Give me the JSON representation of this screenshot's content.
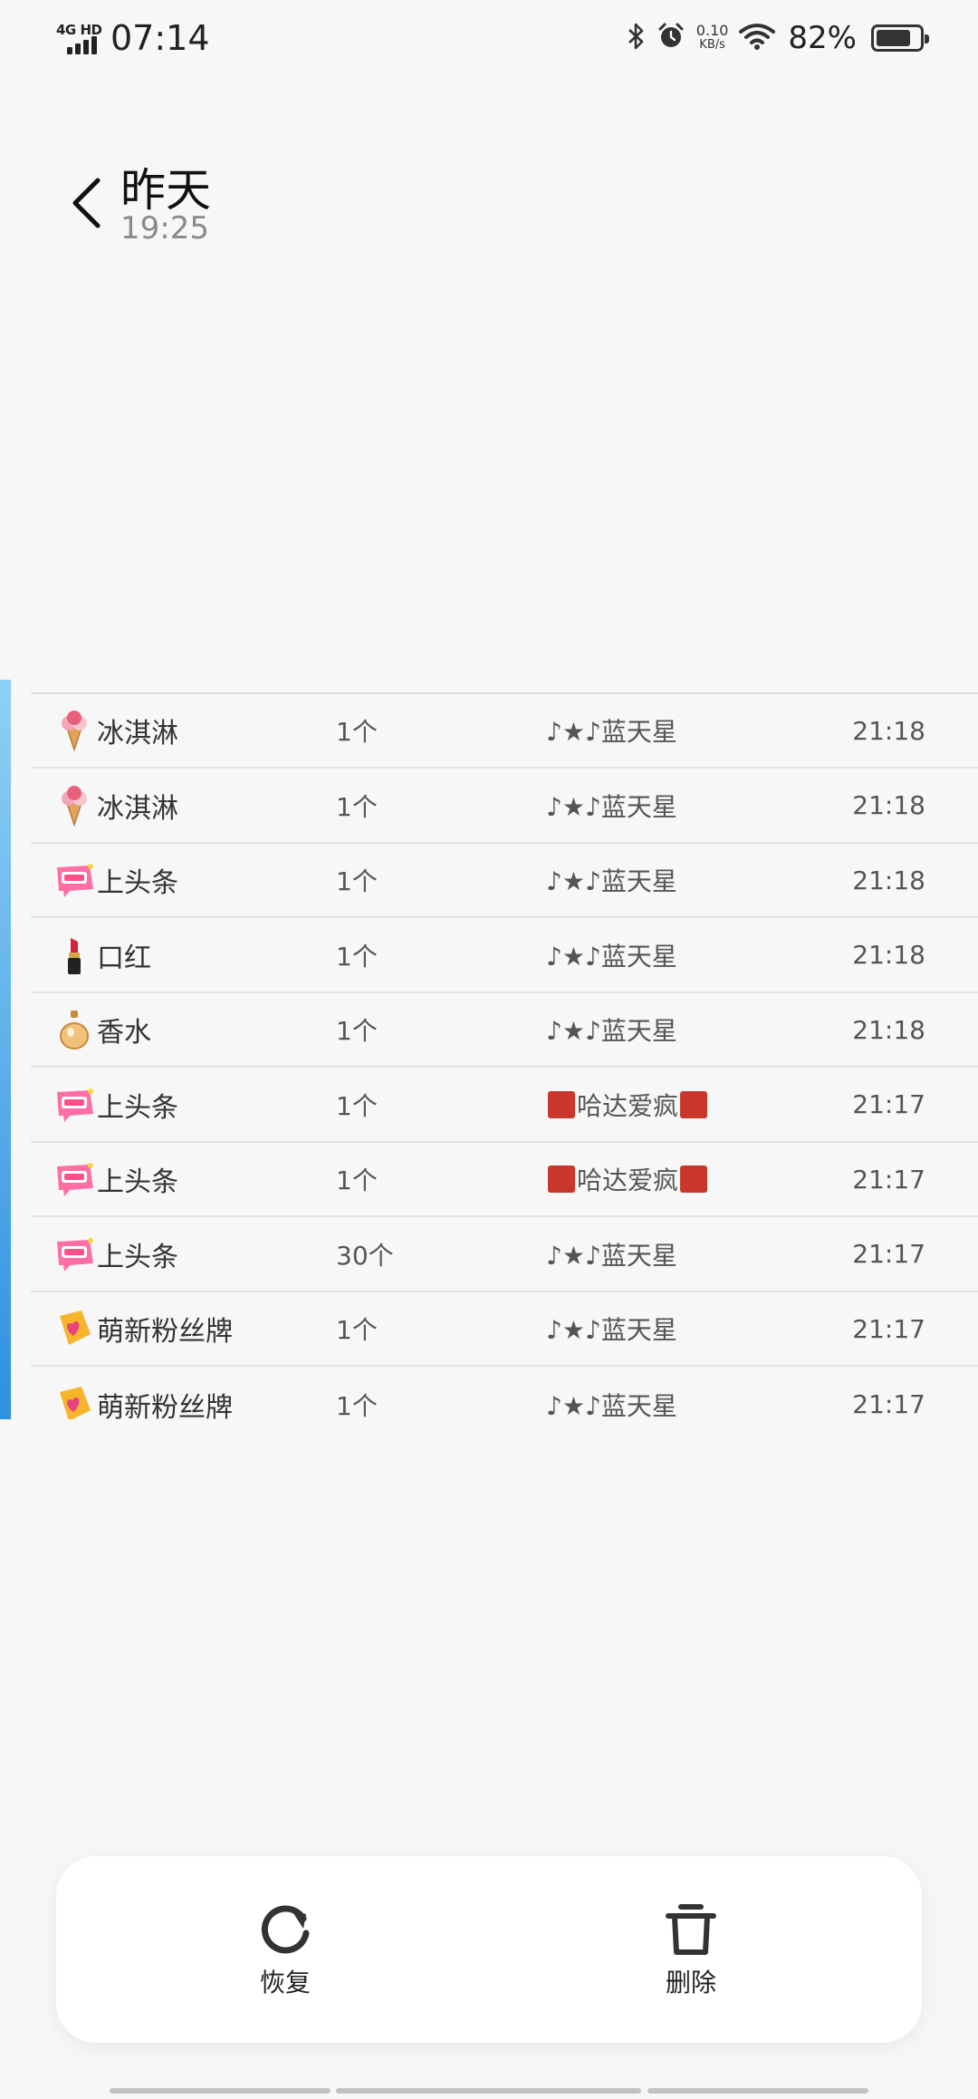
{
  "status_bar": {
    "network": "4G HD",
    "time": "07:14",
    "speed_value": "0.10",
    "speed_unit": "KB/s",
    "battery_percent": "82%",
    "battery_level": 0.82
  },
  "header": {
    "title": "昨天",
    "subtitle": "19:25"
  },
  "gift_records": [
    {
      "gift": "冰淇淋",
      "icon": "ice-cream-icon",
      "qty": "1个",
      "sender": "♪★♪蓝天星",
      "sender_badges": false,
      "time": "21:18"
    },
    {
      "gift": "冰淇淋",
      "icon": "ice-cream-icon",
      "qty": "1个",
      "sender": "♪★♪蓝天星",
      "sender_badges": false,
      "time": "21:18"
    },
    {
      "gift": "上头条",
      "icon": "headline-icon",
      "qty": "1个",
      "sender": "♪★♪蓝天星",
      "sender_badges": false,
      "time": "21:18"
    },
    {
      "gift": "口红",
      "icon": "lipstick-icon",
      "qty": "1个",
      "sender": "♪★♪蓝天星",
      "sender_badges": false,
      "time": "21:18"
    },
    {
      "gift": "香水",
      "icon": "perfume-icon",
      "qty": "1个",
      "sender": "♪★♪蓝天星",
      "sender_badges": false,
      "time": "21:18"
    },
    {
      "gift": "上头条",
      "icon": "headline-icon",
      "qty": "1个",
      "sender": "哈达爱疯",
      "sender_badges": true,
      "time": "21:17"
    },
    {
      "gift": "上头条",
      "icon": "headline-icon",
      "qty": "1个",
      "sender": "哈达爱疯",
      "sender_badges": true,
      "time": "21:17"
    },
    {
      "gift": "上头条",
      "icon": "headline-icon",
      "qty": "30个",
      "sender": "♪★♪蓝天星",
      "sender_badges": false,
      "time": "21:17"
    },
    {
      "gift": "萌新粉丝牌",
      "icon": "fan-badge-icon",
      "qty": "1个",
      "sender": "♪★♪蓝天星",
      "sender_badges": false,
      "time": "21:17"
    },
    {
      "gift": "萌新粉丝牌",
      "icon": "fan-badge-icon",
      "qty": "1个",
      "sender": "♪★♪蓝天星",
      "sender_badges": false,
      "time": "21:17"
    }
  ],
  "actions": {
    "restore_label": "恢复",
    "delete_label": "删除"
  }
}
